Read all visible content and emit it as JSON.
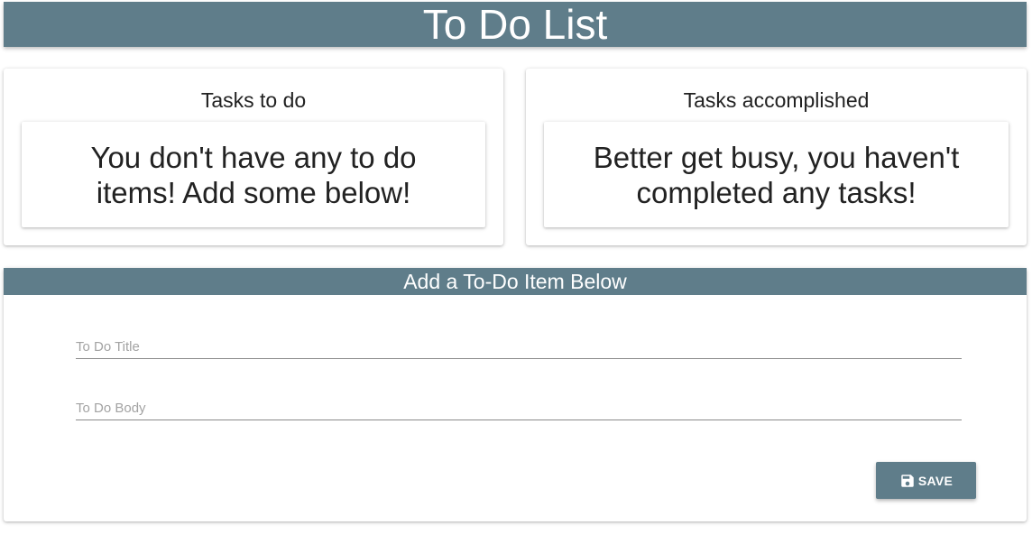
{
  "header": {
    "title": "To Do List"
  },
  "todo_panel": {
    "title": "Tasks to do",
    "empty_message": "You don't have any to do items! Add some below!"
  },
  "done_panel": {
    "title": "Tasks accomplished",
    "empty_message": "Better get busy, you haven't completed any tasks!"
  },
  "form": {
    "header": "Add a To-Do Item Below",
    "title_field": {
      "placeholder": "To Do Title",
      "value": ""
    },
    "body_field": {
      "placeholder": "To Do Body",
      "value": ""
    },
    "save_label": "SAVE",
    "save_icon": "floppy-disk-icon"
  },
  "colors": {
    "accent": "#5f7d8a",
    "background": "#ffffff",
    "text": "#212121"
  }
}
